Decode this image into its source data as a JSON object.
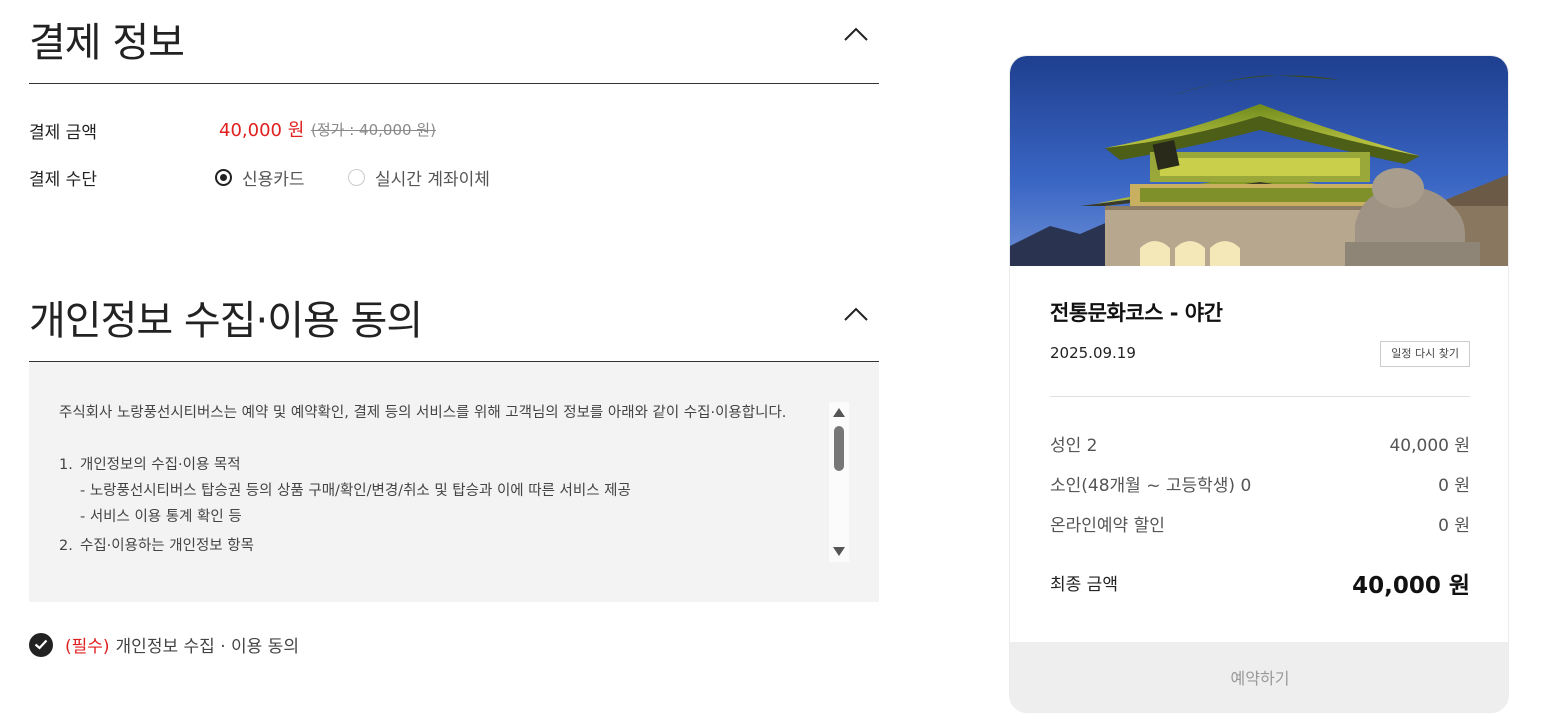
{
  "payment": {
    "title": "결제 정보",
    "amount_label": "결제 금액",
    "amount": "40,000 원",
    "original_price": "(정가 : 40,000 원)",
    "method_label": "결제 수단",
    "methods": [
      {
        "label": "신용카드",
        "selected": true
      },
      {
        "label": "실시간 계좌이체",
        "selected": false
      }
    ]
  },
  "privacy": {
    "title": "개인정보 수집·이용 동의",
    "intro": "주식회사 노랑풍선시티버스는 예약 및 예약확인, 결제 등의 서비스를 위해 고객님의 정보를 아래와 같이 수집·이용합니다.",
    "item1_num": "1.",
    "item1_title": "개인정보의 수집·이용 목적",
    "item1_sub1": "-  노랑풍선시티버스 탑승권 등의 상품 구매/확인/변경/취소 및 탑승과 이에 따른 서비스 제공",
    "item1_sub2": "-  서비스 이용 통계 확인 등",
    "item2_num": "2.",
    "item2_title": "수집·이용하는 개인정보 항목",
    "agree_required": "(필수)",
    "agree_text": "개인정보 수집 · 이용 동의"
  },
  "card": {
    "title": "전통문화코스 - 야간",
    "date": "2025.09.19",
    "reschedule_label": "일정 다시 찾기",
    "items": [
      {
        "label": "성인 2",
        "value": "40,000 원"
      },
      {
        "label": "소인(48개월 ~ 고등학생) 0",
        "value": "0 원"
      },
      {
        "label": "온라인예약 할인",
        "value": "0 원"
      }
    ],
    "total_label": "최종 금액",
    "total_value": "40,000 원",
    "book_label": "예약하기"
  },
  "colors": {
    "accent_red": "#e02020",
    "text_dark": "#222222",
    "terms_bg": "#f3f3f3",
    "button_bg": "#eeeeee"
  }
}
